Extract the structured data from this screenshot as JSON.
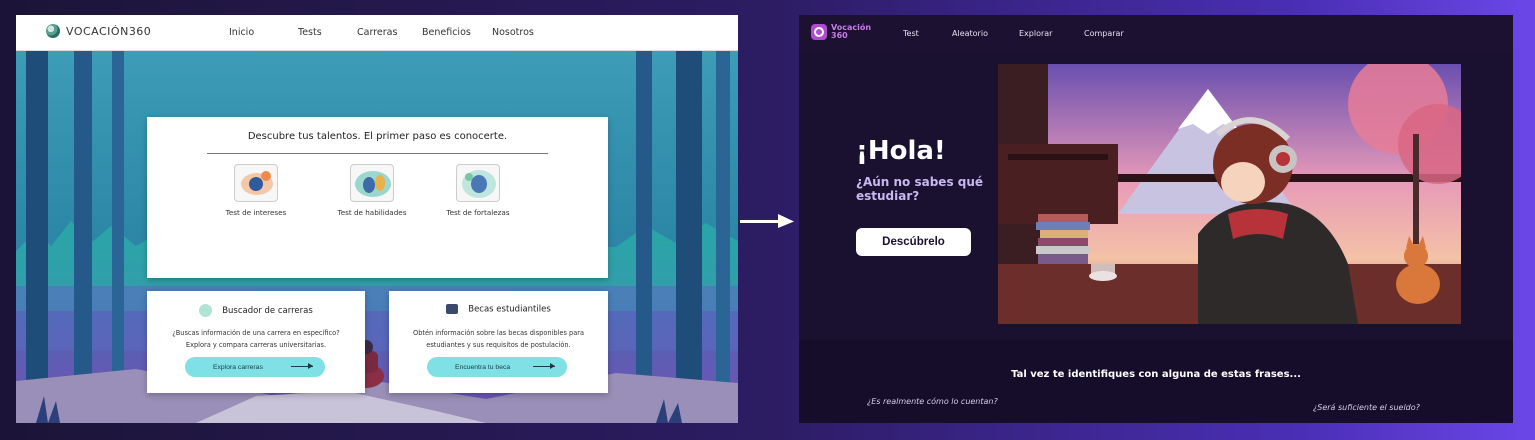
{
  "left_site": {
    "logo_text": "VOCACIÓN360",
    "nav": [
      "Inicio",
      "Tests",
      "Carreras",
      "Beneficios",
      "Nosotros"
    ],
    "hero_headline": "Descubre tus talentos. El primer paso es conocerte.",
    "tests": [
      {
        "label": "Test de intereses",
        "icon": "interests-illustration"
      },
      {
        "label": "Test de habilidades",
        "icon": "skills-illustration"
      },
      {
        "label": "Test de fortalezas",
        "icon": "strengths-illustration"
      }
    ],
    "career_card": {
      "title": "Buscador de carreras",
      "desc_1": "¿Buscas información de una carrera en específico?",
      "desc_2": "Explora y compara carreras universitarias.",
      "button": "Explora carreras"
    },
    "scholarship_card": {
      "title": "Becas estudiantiles",
      "desc_1": "Obtén información sobre las becas disponibles para",
      "desc_2": "estudiantes y sus requisitos de postulación.",
      "button": "Encuentra tu beca"
    }
  },
  "right_site": {
    "logo_line1": "Vocación",
    "logo_line2": "360",
    "nav": [
      "Test",
      "Aleatorio",
      "Explorar",
      "Comparar"
    ],
    "hero_title": "¡Hola!",
    "hero_subtitle": "¿Aún no sabes qué estudiar?",
    "hero_button": "Descúbrelo",
    "tagline": "Tal vez te identifiques con alguna de estas frases...",
    "phrases": [
      "¿Es realmente cómo lo cuentan?",
      "¿Será suficiente el sueldo?"
    ]
  },
  "colors": {
    "accent_teal": "#7fe0e5",
    "accent_purple": "#b14bd1",
    "dark_bg": "#1a1030"
  }
}
